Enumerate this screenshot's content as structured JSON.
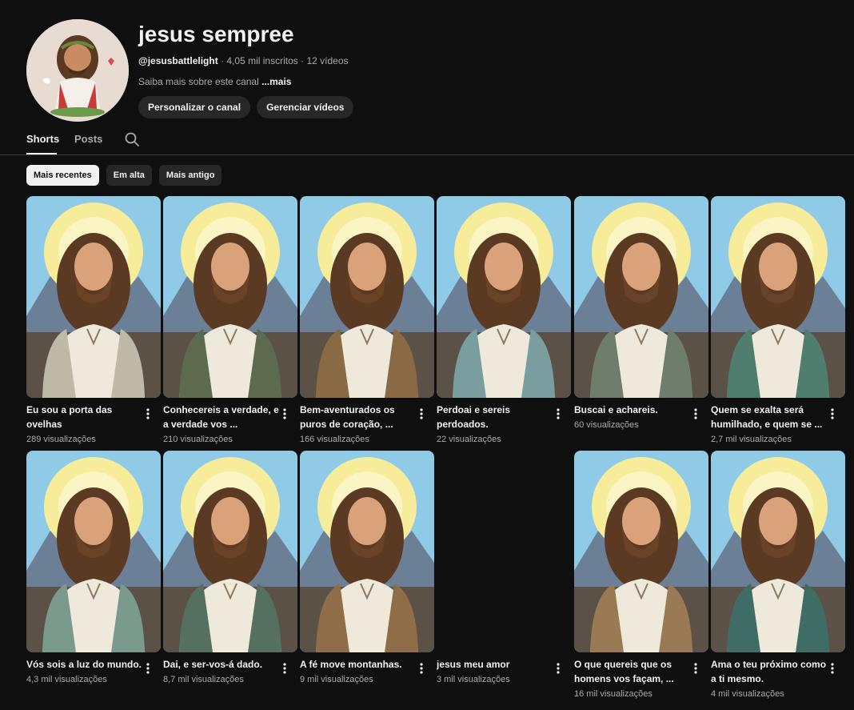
{
  "channel": {
    "title": "jesus sempree",
    "handle": "@jesusbattlelight",
    "subscribers": "4,05 mil inscritos",
    "videos": "12 vídeos",
    "about": "Saiba mais sobre este canal",
    "about_more": "...mais",
    "customize_label": "Personalizar o canal",
    "manage_label": "Gerenciar vídeos"
  },
  "tabs": [
    {
      "label": "Shorts",
      "active": true
    },
    {
      "label": "Posts",
      "active": false
    }
  ],
  "filters": [
    {
      "label": "Mais recentes",
      "selected": true
    },
    {
      "label": "Em alta",
      "selected": false
    },
    {
      "label": "Mais antigo",
      "selected": false
    }
  ],
  "shorts": [
    {
      "title": "Eu sou a porta das ovelhas",
      "views": "289 visualizações",
      "has_thumb": true,
      "robe": "#bfb9a8"
    },
    {
      "title": "Conhecereis a verdade, e a verdade vos ...",
      "views": "210 visualizações",
      "has_thumb": true,
      "robe": "#5c6a4e"
    },
    {
      "title": "Bem-aventurados os puros de coração, ...",
      "views": "166 visualizações",
      "has_thumb": true,
      "robe": "#8a6a45"
    },
    {
      "title": "Perdoai e sereis perdoados.",
      "views": "22 visualizações",
      "has_thumb": true,
      "robe": "#7a9ea0"
    },
    {
      "title": "Buscai e achareis.",
      "views": "60 visualizações",
      "has_thumb": true,
      "robe": "#6f7d6c"
    },
    {
      "title": "Quem se exalta será humilhado, e quem se ...",
      "views": "2,7 mil visualizações",
      "has_thumb": true,
      "robe": "#4f7d6e"
    },
    {
      "title": "Vós sois a luz do mundo.",
      "views": "4,3 mil visualizações",
      "has_thumb": true,
      "robe": "#7b9a8e"
    },
    {
      "title": "Dai, e ser-vos-á dado.",
      "views": "8,7 mil visualizações",
      "has_thumb": true,
      "robe": "#55705e"
    },
    {
      "title": "A fé move montanhas.",
      "views": "9 mil visualizações",
      "has_thumb": true,
      "robe": "#8f6d48"
    },
    {
      "title": "jesus meu amor",
      "views": "3 mil visualizações",
      "has_thumb": false,
      "robe": "#000000"
    },
    {
      "title": "O que quereis que os homens vos façam, ...",
      "views": "16 mil visualizações",
      "has_thumb": true,
      "robe": "#9a7a55"
    },
    {
      "title": "Ama o teu próximo como a ti mesmo.",
      "views": "4 mil visualizações",
      "has_thumb": true,
      "robe": "#3f6d66"
    }
  ],
  "colors": {
    "background": "#0f0f0f",
    "chip": "#272727",
    "text_primary": "#f1f1f1",
    "text_secondary": "#aaaaaa"
  },
  "icons": {
    "search": "search-icon",
    "menu": "more-vert-icon"
  }
}
